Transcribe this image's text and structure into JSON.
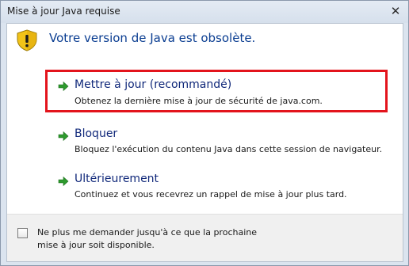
{
  "window": {
    "title": "Mise à jour Java requise",
    "close_glyph": "✕"
  },
  "header": {
    "icon": "warning-shield-icon",
    "text": "Votre version de Java est obsolète."
  },
  "options": [
    {
      "icon": "green-arrow-icon",
      "title": "Mettre à jour (recommandé)",
      "description": "Obtenez la dernière mise à jour de sécurité de java.com.",
      "selected": true
    },
    {
      "icon": "green-arrow-icon",
      "title": "Bloquer",
      "description": "Bloquez l'exécution du contenu Java dans cette session de navigateur.",
      "selected": false
    },
    {
      "icon": "green-arrow-icon",
      "title": "Ultérieurement",
      "description": "Continuez et vous recevrez un rappel de mise à jour plus tard.",
      "selected": false
    }
  ],
  "footer": {
    "checkbox_checked": false,
    "checkbox_label_line1": "Ne plus me demander jusqu'à ce que la prochaine",
    "checkbox_label_line2": "mise à jour soit disponible."
  },
  "colors": {
    "selection_border": "#e3141c",
    "header_text": "#0a3d91",
    "arrow_green": "#2e9a2e"
  }
}
